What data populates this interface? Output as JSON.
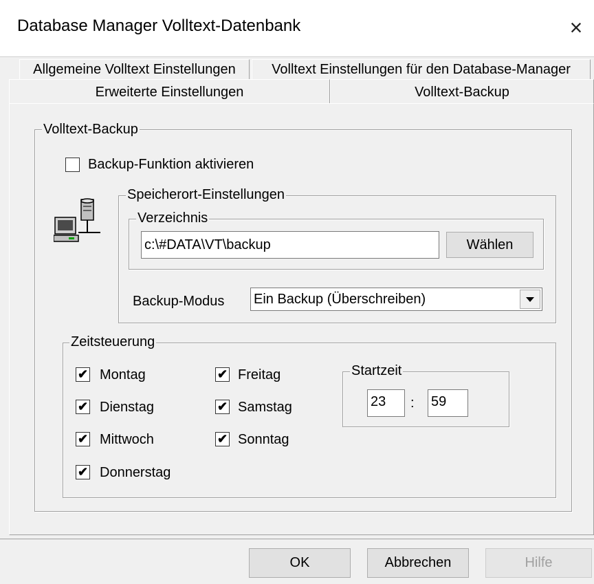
{
  "window": {
    "title": "Database Manager Volltext-Datenbank",
    "close_icon": "×"
  },
  "tabs": {
    "row1": [
      "Allgemeine Volltext Einstellungen",
      "Volltext Einstellungen für den Database-Manager"
    ],
    "row2": [
      "Erweiterte Einstellungen",
      "Volltext-Backup"
    ],
    "active": "Volltext-Backup"
  },
  "backup": {
    "group_title": "Volltext-Backup",
    "enable_label": "Backup-Funktion aktivieren",
    "enable_checked": false,
    "storage": {
      "group_title": "Speicherort-Einstellungen",
      "directory_group_title": "Verzeichnis",
      "directory_value": "c:\\#DATA\\VT\\backup",
      "choose_button": "Wählen",
      "mode_label": "Backup-Modus",
      "mode_value": "Ein Backup (Überschreiben)"
    },
    "schedule": {
      "group_title": "Zeitsteuerung",
      "days": [
        {
          "label": "Montag",
          "checked": true
        },
        {
          "label": "Dienstag",
          "checked": true
        },
        {
          "label": "Mittwoch",
          "checked": true
        },
        {
          "label": "Donnerstag",
          "checked": true
        },
        {
          "label": "Freitag",
          "checked": true
        },
        {
          "label": "Samstag",
          "checked": true
        },
        {
          "label": "Sonntag",
          "checked": true
        }
      ],
      "start_time": {
        "group_title": "Startzeit",
        "hour": "23",
        "separator": ":",
        "minute": "59"
      }
    }
  },
  "buttons": {
    "ok": "OK",
    "cancel": "Abbrechen",
    "help": "Hilfe"
  },
  "check_glyph": "✔"
}
